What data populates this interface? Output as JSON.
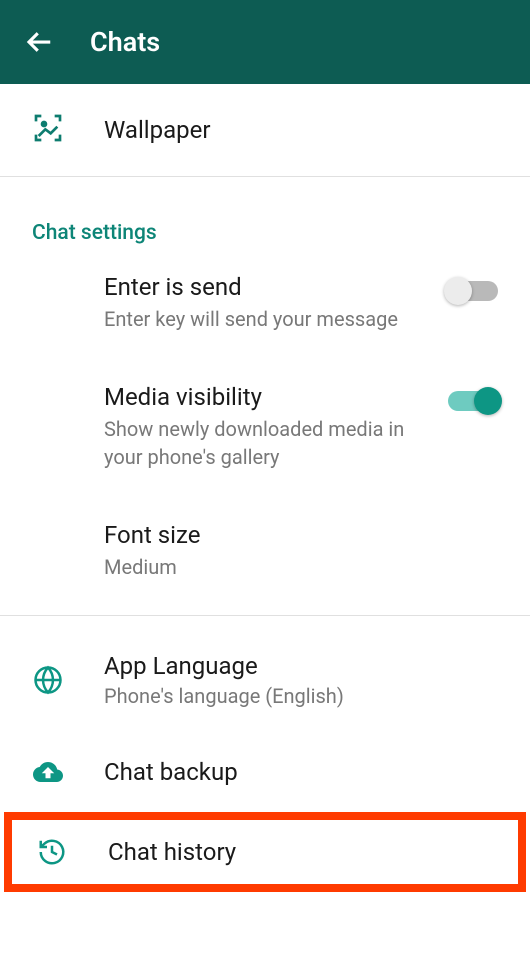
{
  "header": {
    "title": "Chats"
  },
  "wallpaper": {
    "label": "Wallpaper"
  },
  "section": {
    "chat_settings_label": "Chat settings"
  },
  "settings": {
    "enter_send": {
      "title": "Enter is send",
      "subtitle": "Enter key will send your message",
      "enabled": false
    },
    "media_visibility": {
      "title": "Media visibility",
      "subtitle": "Show newly downloaded media in your phone's gallery",
      "enabled": true
    },
    "font_size": {
      "title": "Font size",
      "value": "Medium"
    }
  },
  "app_language": {
    "title": "App Language",
    "subtitle": "Phone's language (English)"
  },
  "chat_backup": {
    "title": "Chat backup"
  },
  "chat_history": {
    "title": "Chat history"
  }
}
